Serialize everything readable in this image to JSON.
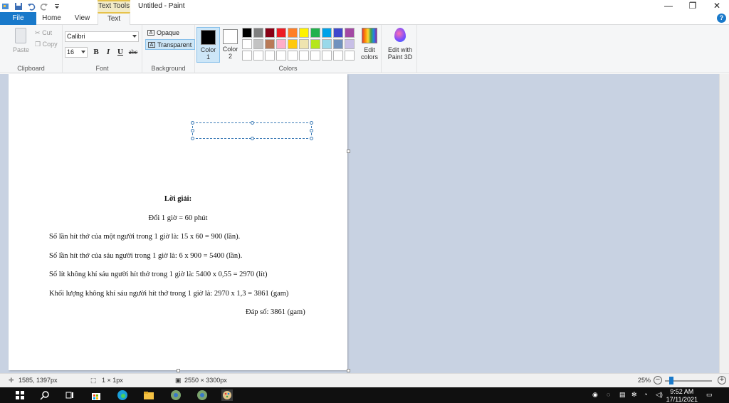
{
  "window": {
    "title": "Untitled - Paint",
    "context_tab_group": "Text Tools",
    "minimize": "—",
    "restore": "❐",
    "close": "✕"
  },
  "tabs": {
    "file": "File",
    "home": "Home",
    "view": "View",
    "text": "Text",
    "help": "?"
  },
  "ribbon": {
    "clipboard": {
      "label": "Clipboard",
      "paste": "Paste",
      "cut": "Cut",
      "copy": "Copy"
    },
    "font": {
      "label": "Font",
      "family": "Calibri",
      "size": "16",
      "bold": "B",
      "italic": "I",
      "underline": "U",
      "strike": "abc"
    },
    "background": {
      "label": "Background",
      "opaque": "Opaque",
      "transparent": "Transparent"
    },
    "colors": {
      "label": "Colors",
      "color1_label": "Color",
      "color1_num": "1",
      "color2_label": "Color",
      "color2_num": "2",
      "color1": "#000000",
      "color2": "#ffffff",
      "palette": [
        "#000000",
        "#7f7f7f",
        "#880015",
        "#ed1c24",
        "#ff7f27",
        "#fff200",
        "#22b14c",
        "#00a2e8",
        "#3f48cc",
        "#a349a4",
        "#ffffff",
        "#c3c3c3",
        "#b97a57",
        "#ffaec9",
        "#ffc90e",
        "#efe4b0",
        "#b5e61d",
        "#99d9ea",
        "#7092be",
        "#c8bfe7",
        "#ffffff",
        "#ffffff",
        "#ffffff",
        "#ffffff",
        "#ffffff",
        "#ffffff",
        "#ffffff",
        "#ffffff",
        "#ffffff",
        "#ffffff"
      ],
      "edit_colors_1": "Edit",
      "edit_colors_2": "colors"
    },
    "paint3d_1": "Edit with",
    "paint3d_2": "Paint 3D"
  },
  "document": {
    "heading": "Lời giải:",
    "line1": "Đổi 1 giờ = 60 phút",
    "line2": "Số lần hít thở của một người trong 1 giờ là: 15 x 60 = 900 (lần).",
    "line3": "Số lần hít thở của sáu người trong 1 giờ là: 6 x 900 = 5400 (lần).",
    "line4": "Số lít không khí sáu người hít thở trong 1 giờ là: 5400 x 0,55 = 2970 (lít)",
    "line5": "Khối lượng không khí sáu người hít thở trong 1 giờ là: 2970 x 1,3 = 3861 (gam)",
    "answer": "Đáp số: 3861 (gam)"
  },
  "status": {
    "cursor_pos": "1585, 1397px",
    "selection_size": "1 × 1px",
    "image_size": "2550 × 3300px",
    "zoom": "25%",
    "zoom_out": "−",
    "zoom_in": "+"
  },
  "taskbar": {
    "time": "9:52 AM",
    "date": "17/11/2021"
  }
}
